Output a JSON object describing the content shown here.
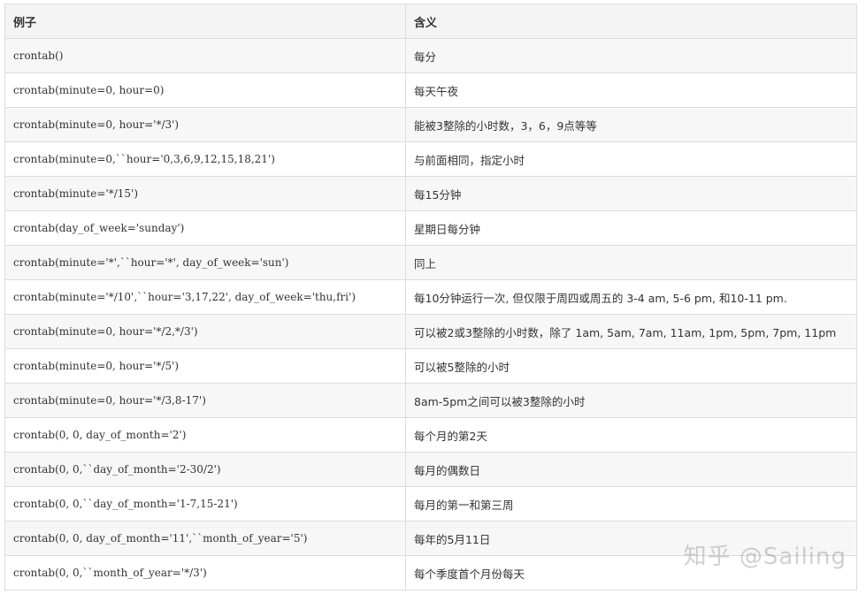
{
  "table": {
    "headers": [
      "例子",
      "含义"
    ],
    "rows": [
      {
        "example": "crontab()",
        "meaning": "每分"
      },
      {
        "example": "crontab(minute=0, hour=0)",
        "meaning": "每天午夜"
      },
      {
        "example": "crontab(minute=0, hour='*/3')",
        "meaning": "能被3整除的小时数，3，6，9点等等"
      },
      {
        "example": "crontab(minute=0,``hour='0,3,6,9,12,15,18,21')",
        "meaning": "与前面相同，指定小时"
      },
      {
        "example": "crontab(minute='*/15')",
        "meaning": "每15分钟"
      },
      {
        "example": "crontab(day_of_week='sunday')",
        "meaning": "星期日每分钟"
      },
      {
        "example": "crontab(minute='*',``hour='*', day_of_week='sun')",
        "meaning": "同上"
      },
      {
        "example": "crontab(minute='*/10',``hour='3,17,22', day_of_week='thu,fri')",
        "meaning": "每10分钟运行一次, 但仅限于周四或周五的 3-4 am, 5-6 pm, 和10-11 pm."
      },
      {
        "example": "crontab(minute=0, hour='*/2,*/3')",
        "meaning": "可以被2或3整除的小时数，除了 1am, 5am, 7am, 11am, 1pm, 5pm, 7pm, 11pm"
      },
      {
        "example": "crontab(minute=0, hour='*/5')",
        "meaning": "可以被5整除的小时"
      },
      {
        "example": "crontab(minute=0, hour='*/3,8-17')",
        "meaning": "8am-5pm之间可以被3整除的小时"
      },
      {
        "example": "crontab(0, 0, day_of_month='2')",
        "meaning": "每个月的第2天"
      },
      {
        "example": "crontab(0, 0,``day_of_month='2-30/2')",
        "meaning": "每月的偶数日"
      },
      {
        "example": "crontab(0, 0,``day_of_month='1-7,15-21')",
        "meaning": "每月的第一和第三周"
      },
      {
        "example": "crontab(0, 0, day_of_month='11',``month_of_year='5')",
        "meaning": "每年的5月11日"
      },
      {
        "example": "crontab(0, 0,``month_of_year='*/3')",
        "meaning": "每个季度首个月份每天"
      }
    ]
  },
  "watermark": "知乎 @Sailing"
}
